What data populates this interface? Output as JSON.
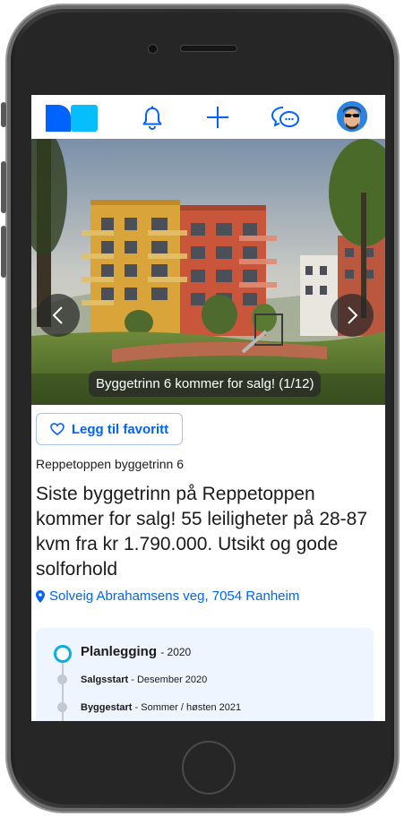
{
  "colors": {
    "brand_dark": "#0063fb",
    "brand_light": "#06befb",
    "accent_blue": "#0063fb",
    "timeline_active": "#0aaee0"
  },
  "topbar": {
    "icons": [
      "bell-icon",
      "plus-icon",
      "chat-icon"
    ]
  },
  "gallery": {
    "caption": "Byggetrinn 6 kommer for salg! (1/12)"
  },
  "favorite": {
    "label": "Legg til favoritt"
  },
  "listing": {
    "project_name": "Reppetoppen byggetrinn 6",
    "headline": "Siste byggetrinn på Reppetoppen kommer for salg! 55 leiligheter på 28-87 kvm fra kr 1.790.000. Utsikt og gode solforhold",
    "address": "Solveig Abrahamsens veg, 7054 Ranheim"
  },
  "timeline": {
    "current": {
      "label": "Planlegging",
      "value": "- 2020"
    },
    "steps": [
      {
        "label": "Salgsstart",
        "value": "- Desember 2020"
      },
      {
        "label": "Byggestart",
        "value": "- Sommer / høsten 2021"
      }
    ]
  }
}
